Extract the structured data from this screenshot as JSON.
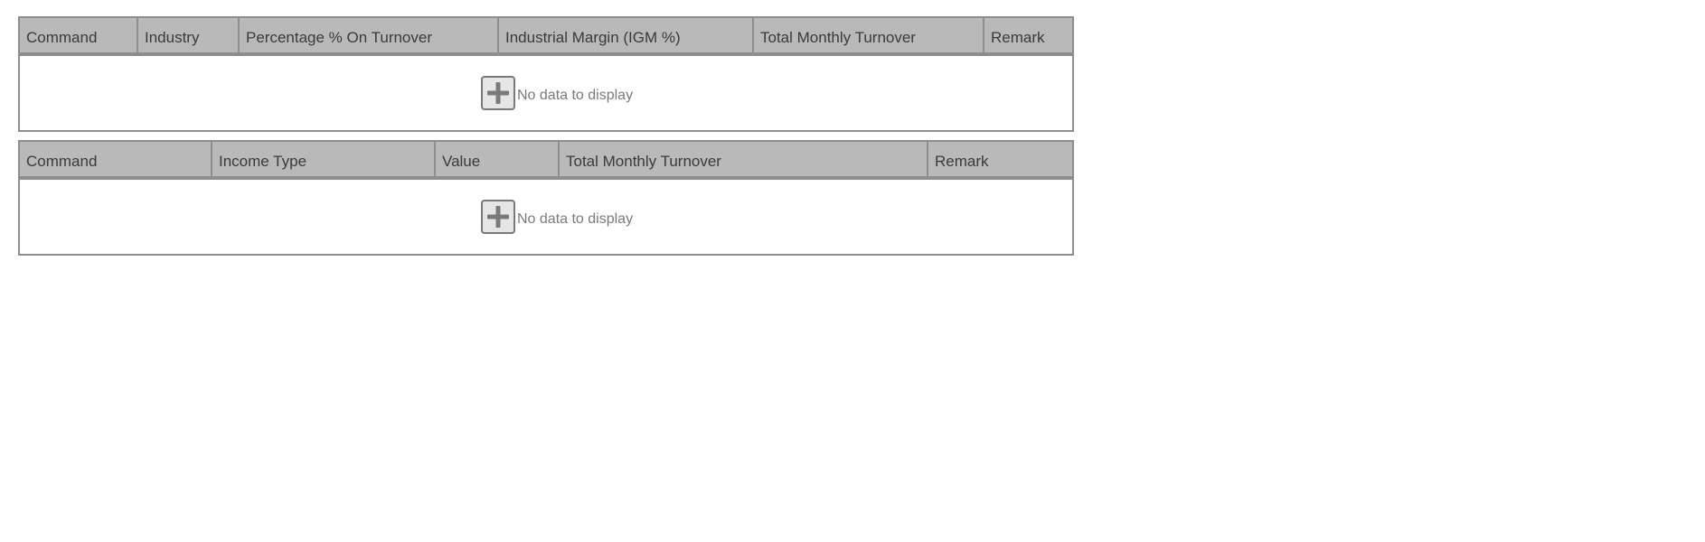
{
  "grids": [
    {
      "columns": [
        "Command",
        "Industry",
        "Percentage % On Turnover",
        "Industrial Margin (IGM %)",
        "Total Monthly Turnover",
        "Remark"
      ],
      "empty_text": "No data to display",
      "add_icon": "plus-icon"
    },
    {
      "columns": [
        "Command",
        "Income Type",
        "Value",
        "Total Monthly Turnover",
        "Remark"
      ],
      "empty_text": "No data to display",
      "add_icon": "plus-icon"
    }
  ],
  "colors": {
    "header_bg": "#b9b9b9",
    "border": "#8e8e8e",
    "header_text": "#3a3a3a",
    "muted_text": "#7a7a7a"
  }
}
